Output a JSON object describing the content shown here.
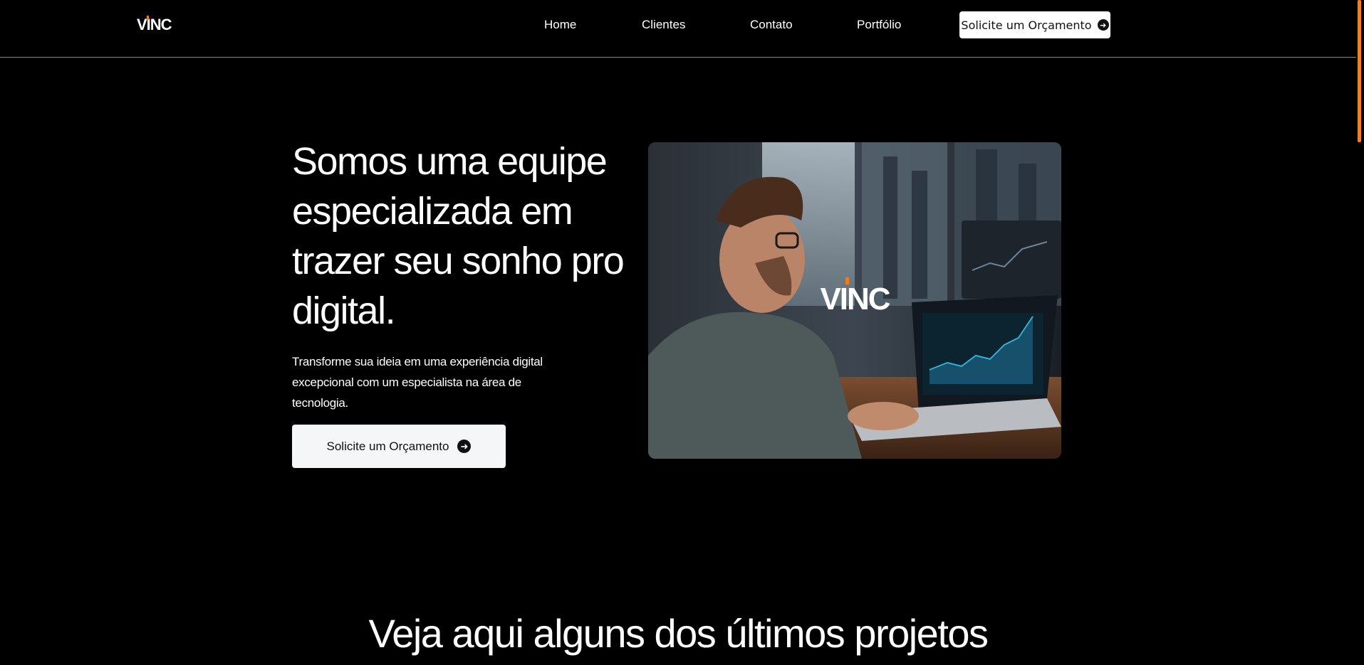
{
  "header": {
    "logo": "VINC",
    "nav": [
      {
        "label": "Home"
      },
      {
        "label": "Clientes"
      },
      {
        "label": "Contato"
      },
      {
        "label": "Portfólio"
      }
    ],
    "cta_label": "Solicite um Orçamento"
  },
  "hero": {
    "title": "Somos uma equipe especializada em trazer seu sonho pro digital.",
    "subtitle": "Transforme sua ideia em uma experiência digital excepcional com um especialista na área de tecnologia.",
    "cta_label": "Solicite um Orçamento",
    "image_logo": "VINC"
  },
  "projects": {
    "title": "Veja aqui alguns dos últimos projetos"
  },
  "colors": {
    "accent": "#ff7a00",
    "background": "#000000",
    "button_bg": "#ffffff"
  },
  "icons": {
    "cta_arrow": "arrow-right-circle-icon"
  }
}
